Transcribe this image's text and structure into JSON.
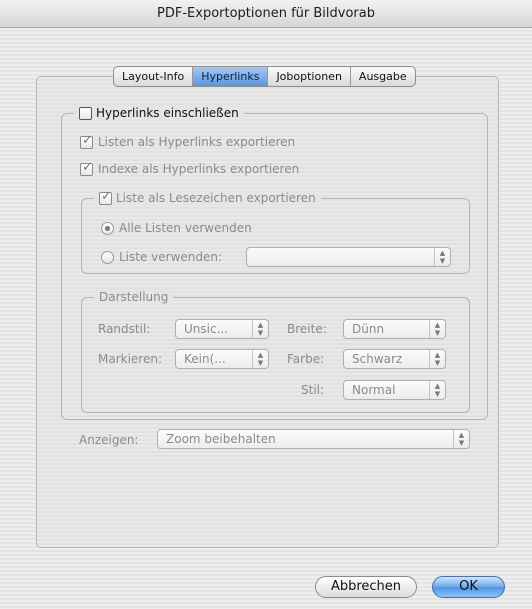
{
  "window": {
    "title": "PDF-Exportoptionen für Bildvorab"
  },
  "tabs": [
    {
      "label": "Layout-Info"
    },
    {
      "label": "Hyperlinks"
    },
    {
      "label": "Joboptionen"
    },
    {
      "label": "Ausgabe"
    }
  ],
  "hyperlinks": {
    "include_label": "Hyperlinks einschließen",
    "include_checked": false,
    "lists_label": "Listen als Hyperlinks exportieren",
    "indexes_label": "Indexe als Hyperlinks exportieren",
    "bookmarks_group": {
      "label": "Liste als Lesezeichen exportieren",
      "all_lists": "Alle Listen verwenden",
      "use_list": "Liste verwenden:",
      "use_list_value": ""
    },
    "appearance": {
      "legend": "Darstellung",
      "border_style_label": "Randstil:",
      "border_style_value": "Unsic...",
      "highlight_label": "Markieren:",
      "highlight_value": "Kein(...",
      "width_label": "Breite:",
      "width_value": "Dünn",
      "color_label": "Farbe:",
      "color_value": "Schwarz",
      "style_label": "Stil:",
      "style_value": "Normal"
    },
    "display_label": "Anzeigen:",
    "display_value": "Zoom beibehalten"
  },
  "buttons": {
    "cancel": "Abbrechen",
    "ok": "OK"
  }
}
